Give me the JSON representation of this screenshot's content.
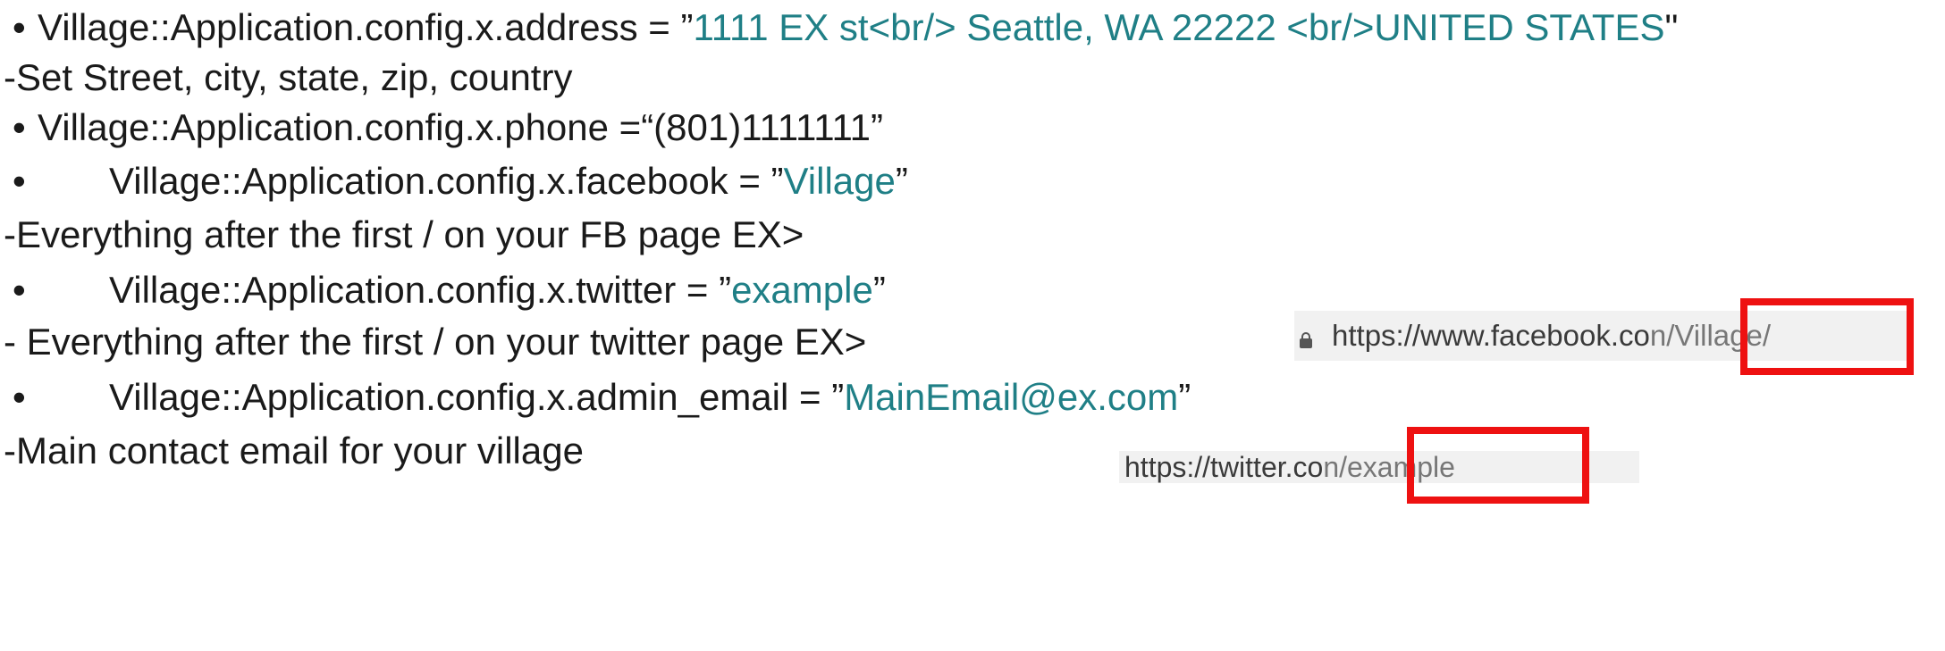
{
  "lines": {
    "address": {
      "bullet": "•",
      "prefix": "Village::Application.config.x.address = ”",
      "value": "1111 EX st<br/> Seattle, WA 22222 <br/>UNITED STATES",
      "suffix": "\""
    },
    "address_note": "-Set Street, city, state, zip, country",
    "phone": {
      "bullet": "•",
      "text": "Village::Application.config.x.phone =“(801)1111111”"
    },
    "facebook": {
      "bullet": "•",
      "prefix": "Village::Application.config.x.facebook = ”",
      "value": "Village",
      "suffix": "”"
    },
    "facebook_note": "-Everything after the first / on your FB page EX>",
    "twitter": {
      "bullet": "•",
      "prefix": "Village::Application.config.x.twitter = ”",
      "value": "example",
      "suffix": "”"
    },
    "twitter_note": "- Everything after the first / on your twitter page EX>",
    "admin_email": {
      "bullet": "•",
      "prefix": "Village::Application.config.x.admin_email = ”",
      "value": "MainEmail@ex.com",
      "suffix": "”"
    },
    "admin_email_note": "-Main contact email for your village"
  },
  "screenshots": {
    "facebook_url": {
      "base": "https://www.facebook.co",
      "highlighted": "n/Village/"
    },
    "twitter_url": {
      "base": "https://twitter.co",
      "highlighted": "n/example"
    }
  },
  "colors": {
    "value_text": "#1f7f86",
    "highlight_box": "#ee1111",
    "body_text": "#1a1a1a"
  }
}
